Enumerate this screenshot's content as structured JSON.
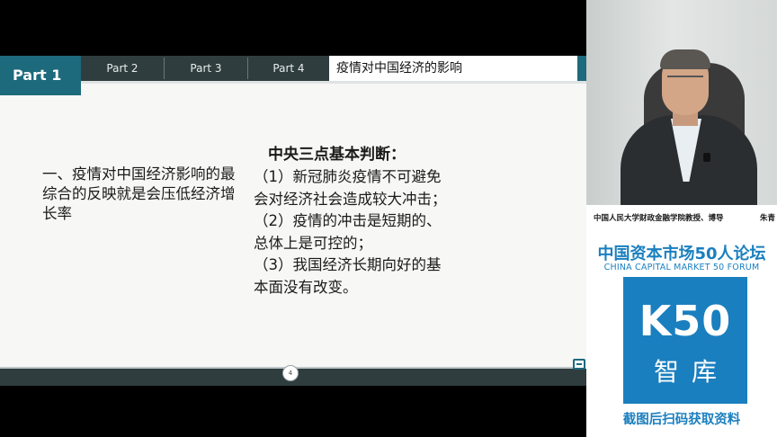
{
  "slide": {
    "tabs": {
      "active": "Part 1",
      "others": [
        "Part 2",
        "Part 3",
        "Part 4"
      ],
      "section_title": "疫情对中国经济的影响"
    },
    "left_text": "一、疫情对中国经济影响的最综合的反映就是会压低经济增长率",
    "right_heading": "中央三点基本判断：",
    "right_lines": [
      "（1）新冠肺炎疫情不可避免",
      "会对经济社会造成较大冲击；",
      "（2）疫情的冲击是短期的、",
      "总体上是可控的；",
      "（3）我国经济长期向好的基",
      "本面没有改变。"
    ],
    "page_number": "4"
  },
  "side": {
    "speaker_caption": "中国人民大学财政金融学院教授、博导",
    "speaker_name": "朱青",
    "forum_title_cn": "中国资本市场50人论坛",
    "forum_title_en": "CHINA CAPITAL MARKET 50 FORUM",
    "logo_main": "K50",
    "logo_sub": "智库",
    "scan_note": "截图后扫码获取资料"
  },
  "colors": {
    "accent_teal": "#1d6a7c",
    "tab_dark": "#2f3d3f",
    "forum_blue": "#1a7fbf"
  }
}
